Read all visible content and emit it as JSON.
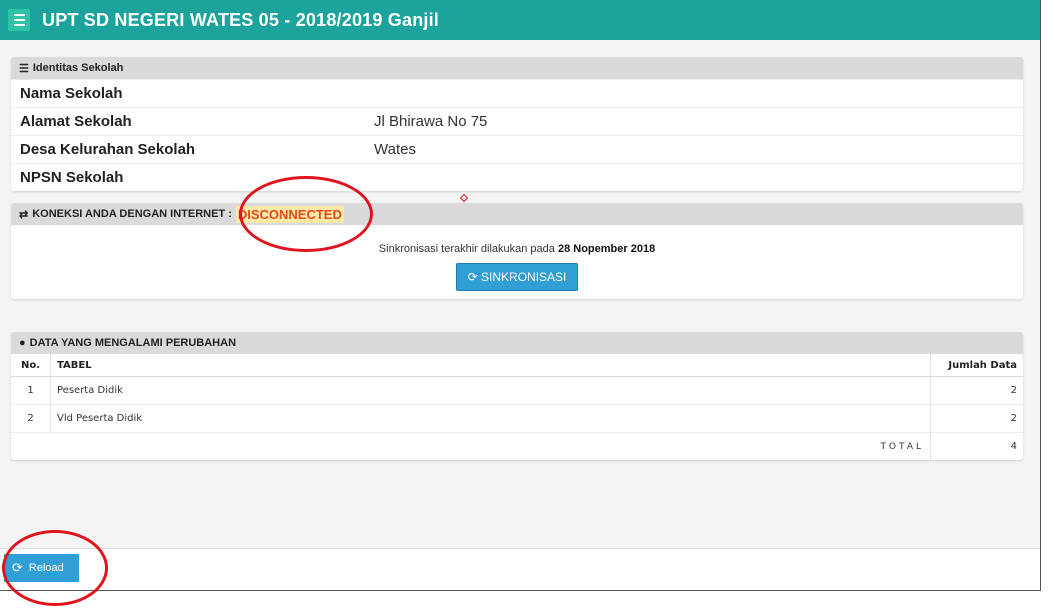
{
  "header": {
    "title": "UPT SD NEGERI WATES 05 - 2018/2019 Ganjil",
    "menu_icon": "hamburger-icon"
  },
  "identitas": {
    "heading": "Identitas Sekolah",
    "icon": "list-icon",
    "rows": [
      {
        "label": "Nama Sekolah",
        "value": ""
      },
      {
        "label": "Alamat Sekolah",
        "value": "Jl Bhirawa No 75"
      },
      {
        "label": "Desa Kelurahan Sekolah",
        "value": "Wates"
      },
      {
        "label": "NPSN Sekolah",
        "value": ""
      }
    ]
  },
  "koneksi": {
    "heading": "KONEKSI ANDA DENGAN INTERNET :",
    "icon": "exchange-icon",
    "status": "DISCONNECTED",
    "status_color": "#e2481b",
    "last_sync_prefix": "Sinkronisasi terakhir dilakukan pada",
    "last_sync_date": "28 Nopember 2018",
    "sync_button": "SINKRONISASI"
  },
  "perubahan": {
    "heading": "DATA YANG MENGALAMI PERUBAHAN",
    "icon": "info-circle-icon",
    "columns": {
      "no": "No.",
      "tabel": "TABEL",
      "jumlah": "Jumlah Data"
    },
    "rows": [
      {
        "no": "1",
        "tabel": "Peserta Didik",
        "jumlah": "2"
      },
      {
        "no": "2",
        "tabel": "Vld Peserta Didik",
        "jumlah": "2"
      }
    ],
    "total_label": "TOTAL",
    "total_value": "4"
  },
  "footer": {
    "reload_button": "Reload"
  },
  "colors": {
    "topbar": "#1ba39c",
    "button": "#2f9fd6",
    "annotation": "#e0141e"
  }
}
